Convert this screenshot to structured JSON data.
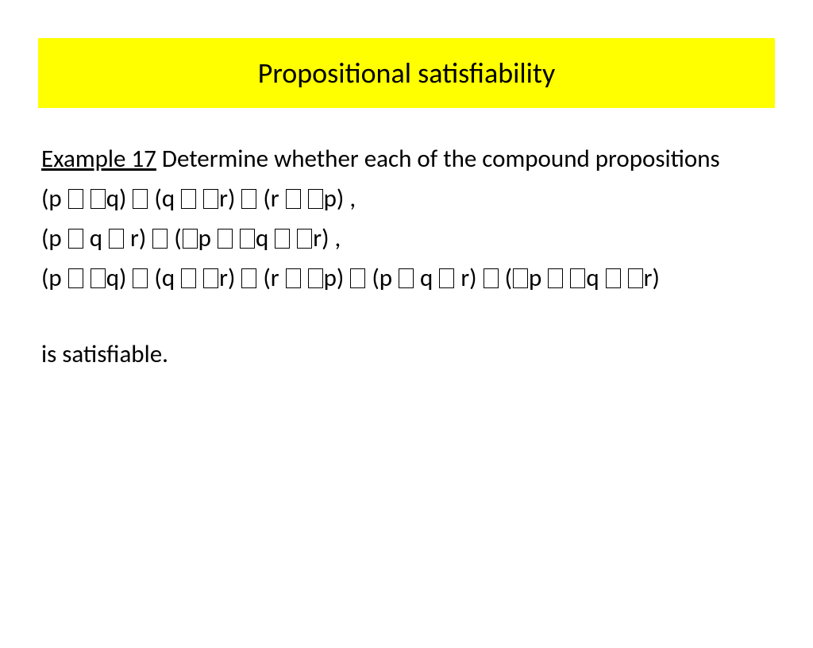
{
  "title": "Propositional satisfiability",
  "example_label": "Example 17",
  "intro_text": " Determine whether each of the compound propositions",
  "formula1_parts": [
    "(p ",
    " ",
    "q) ",
    " (q ",
    " ",
    "r) ",
    " (r ",
    " ",
    "p) ,"
  ],
  "formula2_parts": [
    "(p ",
    " q ",
    " r) ",
    " (",
    "p ",
    " ",
    "q ",
    " ",
    "r) ,"
  ],
  "formula3_parts": [
    "(p ",
    " ",
    "q) ",
    " (q ",
    " ",
    "r) ",
    " (r ",
    " ",
    "p) ",
    " (p ",
    " q ",
    " r) ",
    " (",
    "p ",
    " ",
    "q ",
    " ",
    "r)"
  ],
  "closing_text": "is satisfiable."
}
